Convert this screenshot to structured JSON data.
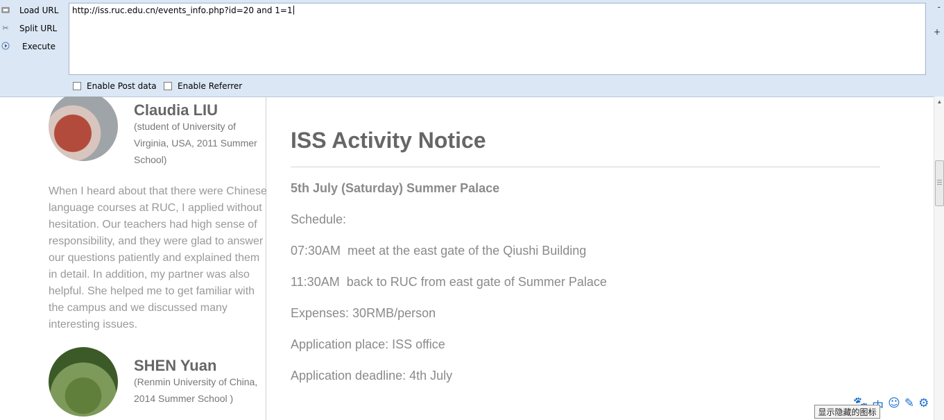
{
  "toolbar": {
    "buttons": [
      {
        "label": "Load URL",
        "icon": "load-url-icon"
      },
      {
        "label": "Split URL",
        "icon": "scissors-icon"
      },
      {
        "label": "Execute",
        "icon": "play-icon"
      }
    ],
    "url_value": "http://iss.ruc.edu.cn/events_info.php?id=20 and 1=1",
    "checkboxes": [
      {
        "label": "Enable Post data",
        "checked": false
      },
      {
        "label": "Enable Referrer",
        "checked": false
      }
    ],
    "right_marks": [
      "-",
      "+"
    ]
  },
  "sidebar": {
    "testimonials": [
      {
        "name": "Claudia LIU",
        "note": "(student of University of Virginia, USA, 2011 Summer School)",
        "quote": "When I heard about that there were Chinese language courses at RUC, I applied without hesitation. Our teachers had high sense of responsibility, and they were glad to answer our questions patiently and explained them in detail. In addition, my partner was also helpful. She helped me to get familiar with the campus and we discussed many interesting issues."
      },
      {
        "name": "SHEN Yuan",
        "note": "(Renmin University of China, 2014 Summer School )"
      }
    ]
  },
  "notice": {
    "title": "ISS Activity Notice",
    "headline": "5th July (Saturday) Summer Palace",
    "lines": [
      "Schedule:",
      "07:30AM  meet at the east gate of the Qiushi Building",
      "11:30AM  back to RUC from east gate of Summer Palace",
      "Expenses: 30RMB/person",
      "Application place: ISS office",
      "Application deadline: 4th July"
    ]
  },
  "ime_tray": {
    "icons": [
      "paw-icon",
      "chinese-mode-icon",
      "smiley-icon",
      "pen-icon",
      "gear-icon"
    ],
    "chinese_mode_label": "中",
    "tooltip": "显示隐藏的图标"
  }
}
